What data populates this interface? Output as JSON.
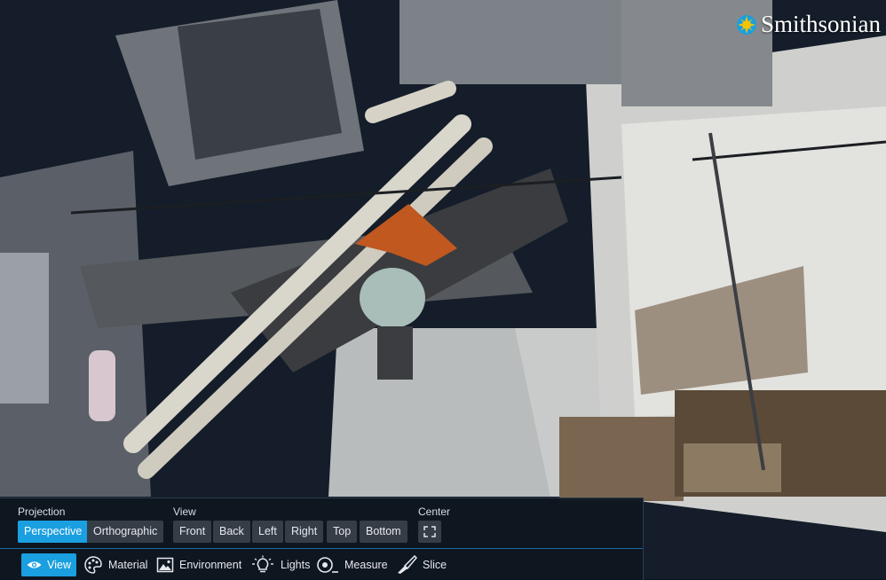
{
  "brand": {
    "name": "Smithsonian"
  },
  "toolbar": {
    "projection": {
      "label": "Projection",
      "options": [
        "Perspective",
        "Orthographic"
      ],
      "selected": "Perspective"
    },
    "view": {
      "label": "View",
      "options": [
        "Front",
        "Back",
        "Left",
        "Right",
        "Top",
        "Bottom"
      ]
    },
    "center": {
      "label": "Center",
      "icon": "fullscreen-icon"
    }
  },
  "tabs": [
    {
      "label": "View",
      "icon": "eye-icon",
      "active": true
    },
    {
      "label": "Material",
      "icon": "palette-icon",
      "active": false
    },
    {
      "label": "Environment",
      "icon": "image-icon",
      "active": false
    },
    {
      "label": "Lights",
      "icon": "lightbulb-icon",
      "active": false
    },
    {
      "label": "Measure",
      "icon": "measure-icon",
      "active": false
    },
    {
      "label": "Slice",
      "icon": "knife-icon",
      "active": false
    }
  ],
  "colors": {
    "accent": "#1a9fe0",
    "panel": "#0e1620",
    "button": "#353d47"
  }
}
